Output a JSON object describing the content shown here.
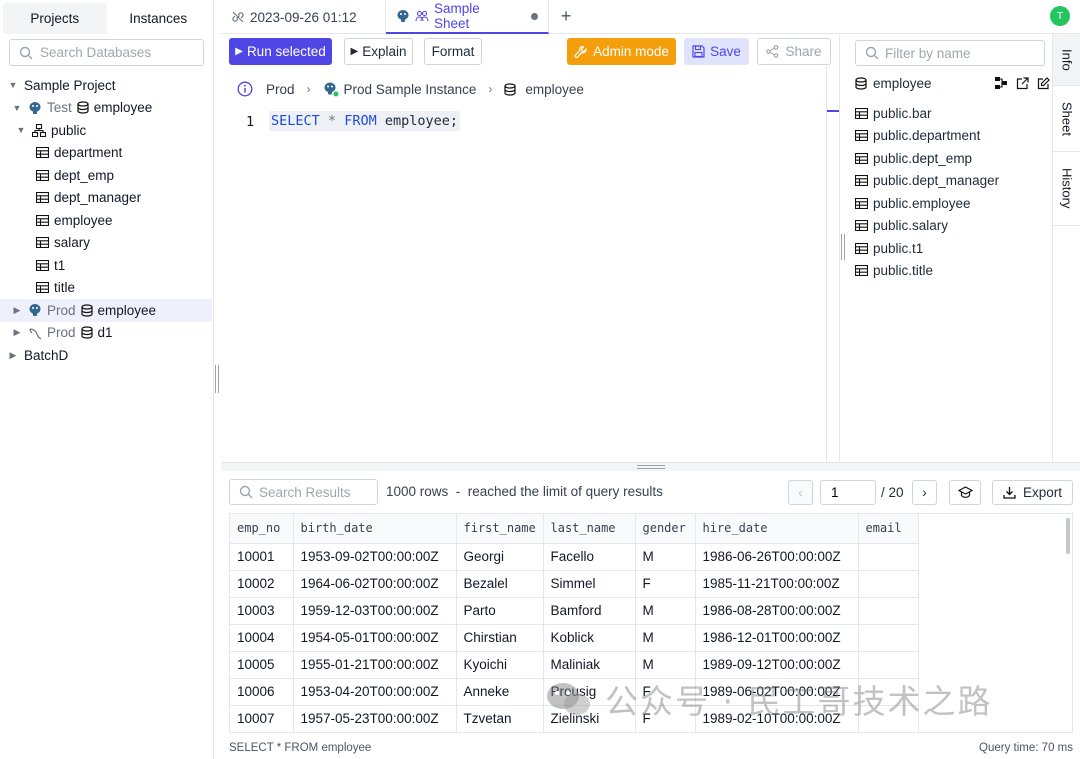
{
  "left_panel": {
    "tabs": [
      "Projects",
      "Instances"
    ],
    "search_placeholder": "Search Databases",
    "tree": {
      "project": "Sample Project",
      "env_test": "Test",
      "db_employee": "employee",
      "schema_public": "public",
      "tables": [
        "department",
        "dept_emp",
        "dept_manager",
        "employee",
        "salary",
        "t1",
        "title"
      ],
      "env_prod": "Prod",
      "db_employee2": "employee",
      "env_prod2": "Prod",
      "db_d1": "d1",
      "batch": "BatchD"
    }
  },
  "tabs": {
    "tab1": "2023-09-26 01:12",
    "tab2": "Sample Sheet"
  },
  "user": {
    "avatar_initial": "T"
  },
  "toolbar": {
    "run": "Run selected",
    "explain": "Explain",
    "format": "Format",
    "admin": "Admin mode",
    "save": "Save",
    "share": "Share"
  },
  "breadcrumb": {
    "env": "Prod",
    "instance": "Prod Sample Instance",
    "database": "employee"
  },
  "editor": {
    "line_number": "1",
    "kw_select": "SELECT",
    "star": "*",
    "kw_from": "FROM",
    "rest": "employee;"
  },
  "right_panel": {
    "filter_placeholder": "Filter by name",
    "db_name": "employee",
    "tables": [
      "public.bar",
      "public.department",
      "public.dept_emp",
      "public.dept_manager",
      "public.employee",
      "public.salary",
      "public.t1",
      "public.title"
    ],
    "vtabs": [
      "Info",
      "Sheet",
      "History"
    ]
  },
  "results": {
    "search_placeholder": "Search Results",
    "info": "1000 rows  -  reached the limit of query results",
    "page": "1",
    "page_total": "/ 20",
    "export": "Export",
    "columns": [
      "emp_no",
      "birth_date",
      "first_name",
      "last_name",
      "gender",
      "hire_date",
      "email"
    ],
    "rows": [
      [
        "10001",
        "1953-09-02T00:00:00Z",
        "Georgi",
        "Facello",
        "M",
        "1986-06-26T00:00:00Z",
        ""
      ],
      [
        "10002",
        "1964-06-02T00:00:00Z",
        "Bezalel",
        "Simmel",
        "F",
        "1985-11-21T00:00:00Z",
        ""
      ],
      [
        "10003",
        "1959-12-03T00:00:00Z",
        "Parto",
        "Bamford",
        "M",
        "1986-08-28T00:00:00Z",
        ""
      ],
      [
        "10004",
        "1954-05-01T00:00:00Z",
        "Chirstian",
        "Koblick",
        "M",
        "1986-12-01T00:00:00Z",
        ""
      ],
      [
        "10005",
        "1955-01-21T00:00:00Z",
        "Kyoichi",
        "Maliniak",
        "M",
        "1989-09-12T00:00:00Z",
        ""
      ],
      [
        "10006",
        "1953-04-20T00:00:00Z",
        "Anneke",
        "Preusig",
        "F",
        "1989-06-02T00:00:00Z",
        ""
      ],
      [
        "10007",
        "1957-05-23T00:00:00Z",
        "Tzvetan",
        "Zielinski",
        "F",
        "1989-02-10T00:00:00Z",
        ""
      ]
    ],
    "status_left": "SELECT * FROM employee",
    "status_right": "Query time: 70 ms"
  },
  "watermark": "公众号 · 民工哥技术之路"
}
